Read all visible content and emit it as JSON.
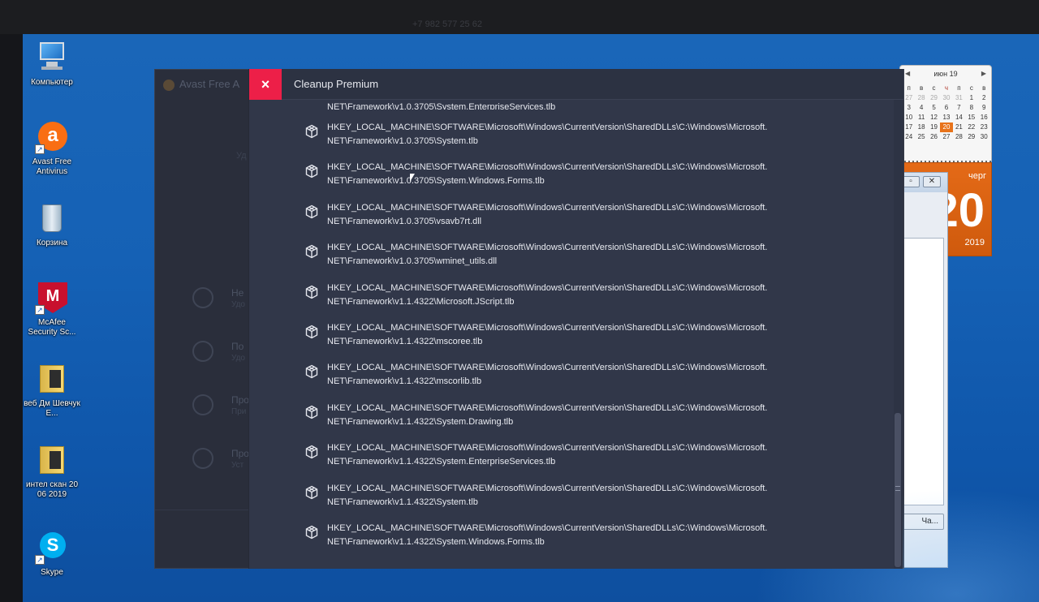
{
  "top_bar": {
    "text": "+7 982 577 25 62"
  },
  "desktop_icons": [
    {
      "label": "Компьютер",
      "icon": "computer-icon"
    },
    {
      "label": "Avast Free Antivirus",
      "icon": "avast-icon"
    },
    {
      "label": "Корзина",
      "icon": "recycle-bin-icon"
    },
    {
      "label": "McAfee Security Sc...",
      "icon": "mcafee-icon"
    },
    {
      "label": "веб Дм Шевчук Е...",
      "icon": "folder-icon"
    },
    {
      "label": "интел скан 20 06 2019",
      "icon": "folder-icon"
    },
    {
      "label": "Skype",
      "icon": "skype-icon"
    }
  ],
  "calendar": {
    "month": "июн 19",
    "weekdays": [
      "п",
      "в",
      "с",
      "ч",
      "п",
      "с",
      "в"
    ],
    "weeks": [
      [
        "27",
        "28",
        "29",
        "30",
        "31",
        "1",
        "2"
      ],
      [
        "3",
        "4",
        "5",
        "6",
        "7",
        "8",
        "9"
      ],
      [
        "10",
        "11",
        "12",
        "13",
        "14",
        "15",
        "16"
      ],
      [
        "17",
        "18",
        "19",
        "20",
        "21",
        "22",
        "23"
      ],
      [
        "24",
        "25",
        "26",
        "27",
        "28",
        "29",
        "30"
      ]
    ],
    "today": "20",
    "page_weekday": "черг",
    "page_day": "20",
    "page_year": "2019"
  },
  "bg_window": {
    "more_button": "Ча..."
  },
  "avast": {
    "title": "Avast Free A",
    "ghost_text": "Уд",
    "side_items": [
      {
        "title": "Не",
        "sub": "Удо"
      },
      {
        "title": "По",
        "sub": "Удо"
      },
      {
        "title": "Про",
        "sub": "При"
      },
      {
        "title": "Про",
        "sub": "Уст"
      }
    ]
  },
  "cleanup": {
    "title": "Cleanup Premium",
    "close_label": "×",
    "cut_line": "NET\\Framework\\v1.0.3705\\System.EnterpriseServices.tlb",
    "entries": [
      {
        "line1": "HKEY_LOCAL_MACHINE\\SOFTWARE\\Microsoft\\Windows\\CurrentVersion\\SharedDLLs\\C:\\Windows\\Microsoft.",
        "line2": "NET\\Framework\\v1.0.3705\\System.tlb"
      },
      {
        "line1": "HKEY_LOCAL_MACHINE\\SOFTWARE\\Microsoft\\Windows\\CurrentVersion\\SharedDLLs\\C:\\Windows\\Microsoft.",
        "line2": "NET\\Framework\\v1.0.3705\\System.Windows.Forms.tlb"
      },
      {
        "line1": "HKEY_LOCAL_MACHINE\\SOFTWARE\\Microsoft\\Windows\\CurrentVersion\\SharedDLLs\\C:\\Windows\\Microsoft.",
        "line2": "NET\\Framework\\v1.0.3705\\vsavb7rt.dll"
      },
      {
        "line1": "HKEY_LOCAL_MACHINE\\SOFTWARE\\Microsoft\\Windows\\CurrentVersion\\SharedDLLs\\C:\\Windows\\Microsoft.",
        "line2": "NET\\Framework\\v1.0.3705\\wminet_utils.dll"
      },
      {
        "line1": "HKEY_LOCAL_MACHINE\\SOFTWARE\\Microsoft\\Windows\\CurrentVersion\\SharedDLLs\\C:\\Windows\\Microsoft.",
        "line2": "NET\\Framework\\v1.1.4322\\Microsoft.JScript.tlb"
      },
      {
        "line1": "HKEY_LOCAL_MACHINE\\SOFTWARE\\Microsoft\\Windows\\CurrentVersion\\SharedDLLs\\C:\\Windows\\Microsoft.",
        "line2": "NET\\Framework\\v1.1.4322\\mscoree.tlb"
      },
      {
        "line1": "HKEY_LOCAL_MACHINE\\SOFTWARE\\Microsoft\\Windows\\CurrentVersion\\SharedDLLs\\C:\\Windows\\Microsoft.",
        "line2": "NET\\Framework\\v1.1.4322\\mscorlib.tlb"
      },
      {
        "line1": "HKEY_LOCAL_MACHINE\\SOFTWARE\\Microsoft\\Windows\\CurrentVersion\\SharedDLLs\\C:\\Windows\\Microsoft.",
        "line2": "NET\\Framework\\v1.1.4322\\System.Drawing.tlb"
      },
      {
        "line1": "HKEY_LOCAL_MACHINE\\SOFTWARE\\Microsoft\\Windows\\CurrentVersion\\SharedDLLs\\C:\\Windows\\Microsoft.",
        "line2": "NET\\Framework\\v1.1.4322\\System.EnterpriseServices.tlb"
      },
      {
        "line1": "HKEY_LOCAL_MACHINE\\SOFTWARE\\Microsoft\\Windows\\CurrentVersion\\SharedDLLs\\C:\\Windows\\Microsoft.",
        "line2": "NET\\Framework\\v1.1.4322\\System.tlb"
      },
      {
        "line1": "HKEY_LOCAL_MACHINE\\SOFTWARE\\Microsoft\\Windows\\CurrentVersion\\SharedDLLs\\C:\\Windows\\Microsoft.",
        "line2": "NET\\Framework\\v1.1.4322\\System.Windows.Forms.tlb"
      }
    ],
    "entry_icon": "registry-cube-icon"
  },
  "colors": {
    "close_red": "#ed1f48",
    "panel_dark": "#313749",
    "desktop_blue": "#1561b5",
    "calendar_orange": "#e46a17"
  }
}
